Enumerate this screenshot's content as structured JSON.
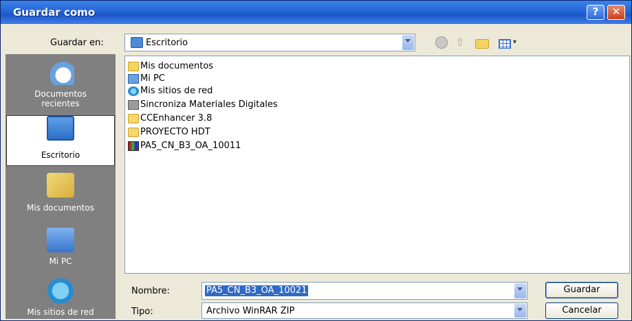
{
  "window": {
    "title": "Guardar como",
    "help_symbol": "?",
    "close_symbol": "✕"
  },
  "toolbar": {
    "save_in_label": "Guardar en:",
    "save_in_value": "Escritorio",
    "icons": [
      "back-icon",
      "up-folder-icon",
      "new-folder-icon",
      "views-menu-icon"
    ]
  },
  "places": [
    {
      "label": "Documentos recientes",
      "icon": "recent-documents-icon"
    },
    {
      "label": "Escritorio",
      "icon": "desktop-icon"
    },
    {
      "label": "Mis documentos",
      "icon": "my-documents-icon"
    },
    {
      "label": "Mi PC",
      "icon": "my-computer-icon"
    },
    {
      "label": "Mis sitios de red",
      "icon": "network-places-icon"
    }
  ],
  "files": [
    {
      "name": "Mis documentos",
      "icon": "my-documents-icon"
    },
    {
      "name": "Mi PC",
      "icon": "my-computer-icon"
    },
    {
      "name": "Mis sitios de red",
      "icon": "network-places-icon"
    },
    {
      "name": "Sincroniza Materiales Digitales",
      "icon": "sync-shortcut-icon"
    },
    {
      "name": "CCEnhancer 3.8",
      "icon": "folder-icon"
    },
    {
      "name": "PROYECTO HDT",
      "icon": "folder-icon"
    },
    {
      "name": "PA5_CN_B3_OA_10011",
      "icon": "winrar-archive-icon"
    }
  ],
  "form": {
    "name_label": "Nombre:",
    "name_value": "PA5_CN_B3_OA_10021",
    "type_label": "Tipo:",
    "type_value": "Archivo WinRAR ZIP"
  },
  "buttons": {
    "save": "Guardar",
    "cancel": "Cancelar"
  },
  "colors": {
    "titlebar": "#2a69d8",
    "selection": "#316ac5",
    "places_bg": "#808080",
    "dialog_bg": "#ece9d8"
  }
}
